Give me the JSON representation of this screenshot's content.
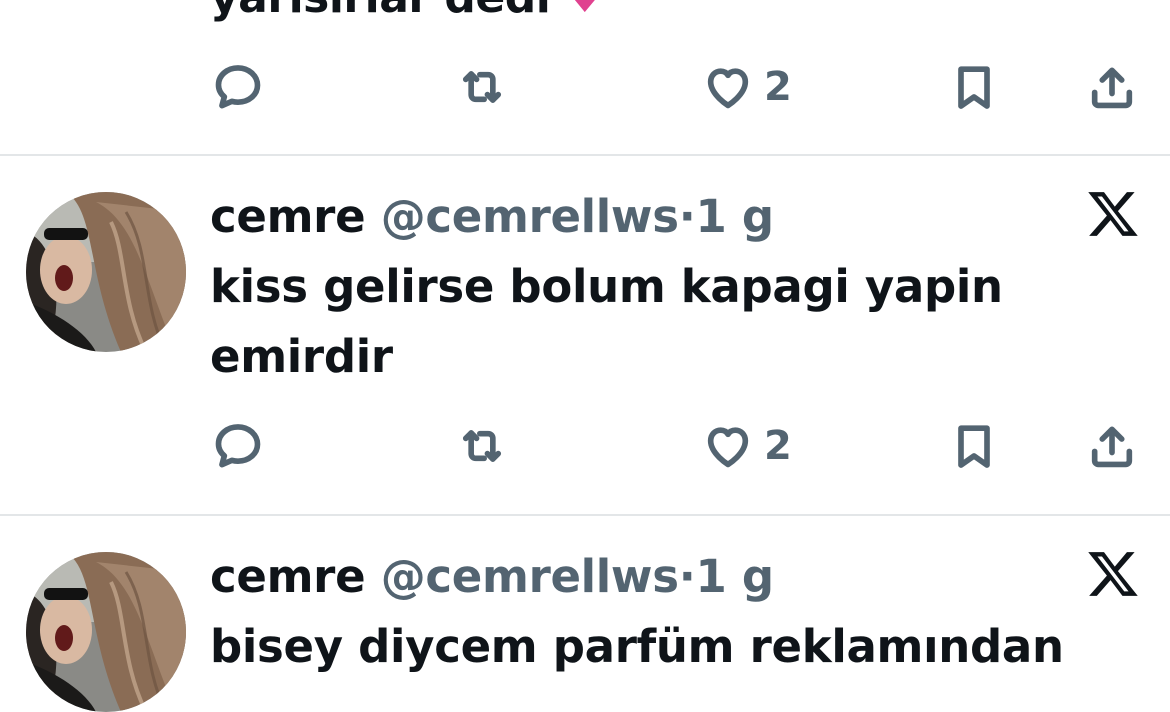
{
  "previous_tweet": {
    "text_fragment": "yarisirlar dedi",
    "emoji": "♥",
    "actions": {
      "like_count": "2"
    }
  },
  "tweets": [
    {
      "display_name": "cemre",
      "handle": "@cemrellws",
      "separator": "·",
      "time": "1 g",
      "text": "kiss gelirse bolum kapagi yapin emirdir",
      "actions": {
        "like_count": "2"
      }
    },
    {
      "display_name": "cemre",
      "handle": "@cemrellws",
      "separator": "·",
      "time": "1 g",
      "text": "bisey diycem parfüm reklamından",
      "actions": {
        "like_count": ""
      }
    }
  ],
  "icons": {
    "reply": "reply-icon",
    "retweet": "retweet-icon",
    "like": "heart-icon",
    "bookmark": "bookmark-icon",
    "share": "share-icon",
    "brand": "x-logo-icon"
  },
  "colors": {
    "text_primary": "#0f1419",
    "text_secondary": "#536471",
    "divider": "#e3e6e8",
    "emoji_heart": "#e0418f"
  }
}
